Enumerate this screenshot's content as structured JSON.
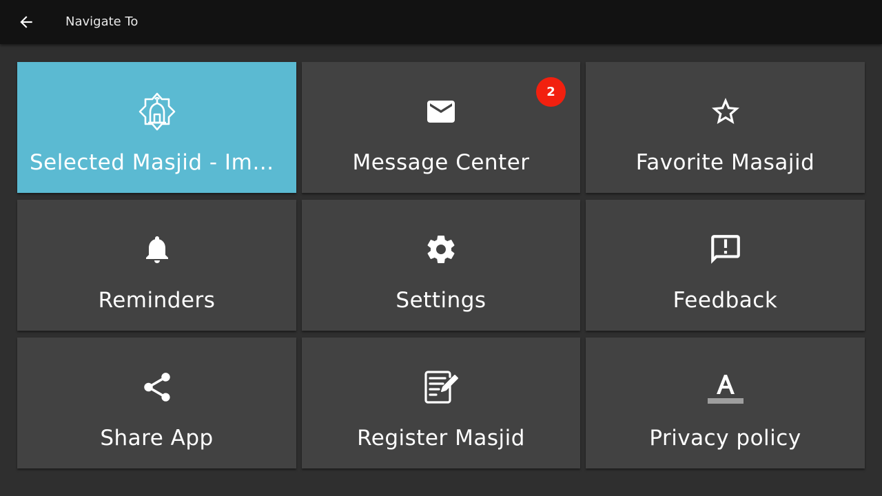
{
  "header": {
    "title": "Navigate To",
    "back_icon": "arrow-left-icon"
  },
  "colors": {
    "selected_tile": "#5bbad2",
    "tile": "#424242",
    "badge": "#f2200f",
    "header": "#121212",
    "background": "#2f2f2f"
  },
  "tiles": [
    {
      "label": "Selected Masjid - Imam Ali Mosque",
      "icon": "masjid-icon",
      "selected": true
    },
    {
      "label": "Message Center",
      "icon": "envelope-icon",
      "badge": "2"
    },
    {
      "label": "Favorite Masajid",
      "icon": "star-icon"
    },
    {
      "label": "Reminders",
      "icon": "bell-icon"
    },
    {
      "label": "Settings",
      "icon": "gear-icon"
    },
    {
      "label": "Feedback",
      "icon": "feedback-icon"
    },
    {
      "label": "Share App",
      "icon": "share-icon"
    },
    {
      "label": "Register Masjid",
      "icon": "edit-form-icon"
    },
    {
      "label": "Privacy policy",
      "icon": "text-format-icon"
    }
  ]
}
